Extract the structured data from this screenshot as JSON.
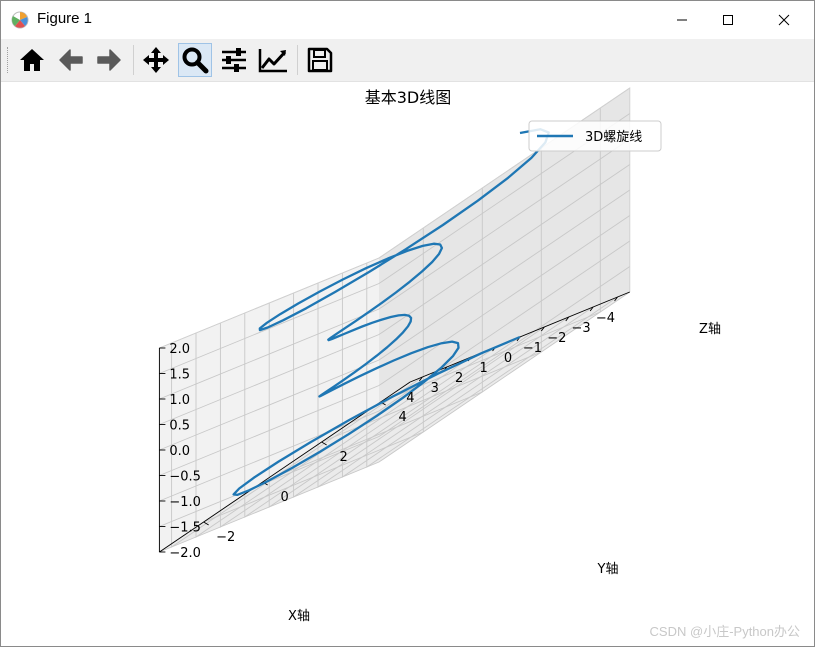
{
  "window": {
    "title": "Figure 1",
    "controls": {
      "minimize": "—",
      "maximize": "☐",
      "close": "✕"
    }
  },
  "toolbar": {
    "buttons": [
      {
        "name": "home",
        "icon": "home-icon"
      },
      {
        "name": "back",
        "icon": "arrow-left-icon"
      },
      {
        "name": "forward",
        "icon": "arrow-right-icon"
      },
      {
        "name": "pan",
        "icon": "move-icon"
      },
      {
        "name": "zoom",
        "icon": "magnifier-icon",
        "active": true
      },
      {
        "name": "subplots",
        "icon": "sliders-icon"
      },
      {
        "name": "customize",
        "icon": "trend-icon"
      },
      {
        "name": "save",
        "icon": "floppy-icon"
      }
    ]
  },
  "chart_data": {
    "type": "line",
    "projection": "3d",
    "title": "基本3D线图",
    "xlabel": "X轴",
    "ylabel": "Y轴",
    "zlabel": "Z轴",
    "legend": {
      "entries": [
        "3D螺旋线"
      ],
      "placement": "top-right"
    },
    "grid": true,
    "series": [
      {
        "name": "3D螺旋线",
        "color": "#1f77b4",
        "parametric": {
          "t_range": [
            -12.566,
            12.566
          ],
          "z": "t / 6.283",
          "r": "z^2 + 1",
          "x": "r * sin(t)",
          "y": "r * cos(t)",
          "samples": 100
        }
      }
    ],
    "xlim": [
      -4.5,
      4.5
    ],
    "ylim": [
      -3.5,
      5
    ],
    "zlim": [
      -2,
      2
    ],
    "xticks": [
      "−4",
      "−3",
      "−2",
      "−1",
      "0",
      "1",
      "2",
      "3",
      "4"
    ],
    "yticks": [
      "−2",
      "0",
      "2",
      "4"
    ],
    "zticks": [
      "−2.0",
      "−1.5",
      "−1.0",
      "−0.5",
      "0.0",
      "0.5",
      "1.0",
      "1.5",
      "2.0"
    ]
  },
  "watermark": "CSDN @小庄-Python办公"
}
